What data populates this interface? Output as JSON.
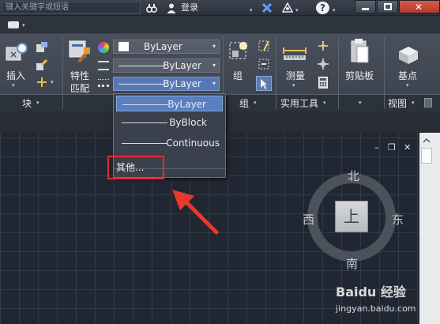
{
  "titlebar": {
    "search_placeholder": "键入关键字或短语",
    "login_label": "登录",
    "help_icon_text": "?",
    "dropdown_arrow": "▾"
  },
  "ribbon": {
    "insert_label": "插入",
    "match_props_label": "特性",
    "match_props_label2": "匹配",
    "color_combo": "ByLayer",
    "linetype_combo": "ByLayer",
    "lineweight_combo": "ByLayer",
    "group_label": "组",
    "measure_label": "测量",
    "clipboard_label": "剪贴板",
    "base_label": "基点"
  },
  "panels": {
    "block": "块",
    "group": "组",
    "utilities": "实用工具",
    "view": "视图"
  },
  "dropdown": {
    "items": [
      "ByLayer",
      "ByBlock",
      "Continuous"
    ],
    "other": "其他..."
  },
  "viewport": {
    "minimize": "–",
    "restore": "❐",
    "close": "✕"
  },
  "viewcube": {
    "north": "北",
    "south": "南",
    "east": "东",
    "west": "西",
    "face": "上"
  },
  "watermark": {
    "main": "Baidu 经验",
    "sub": "jingyan.baidu.com"
  },
  "colors": {
    "accent": "#5a7ec2",
    "highlight_box": "#e52a2a",
    "arrow": "#e8382f"
  }
}
